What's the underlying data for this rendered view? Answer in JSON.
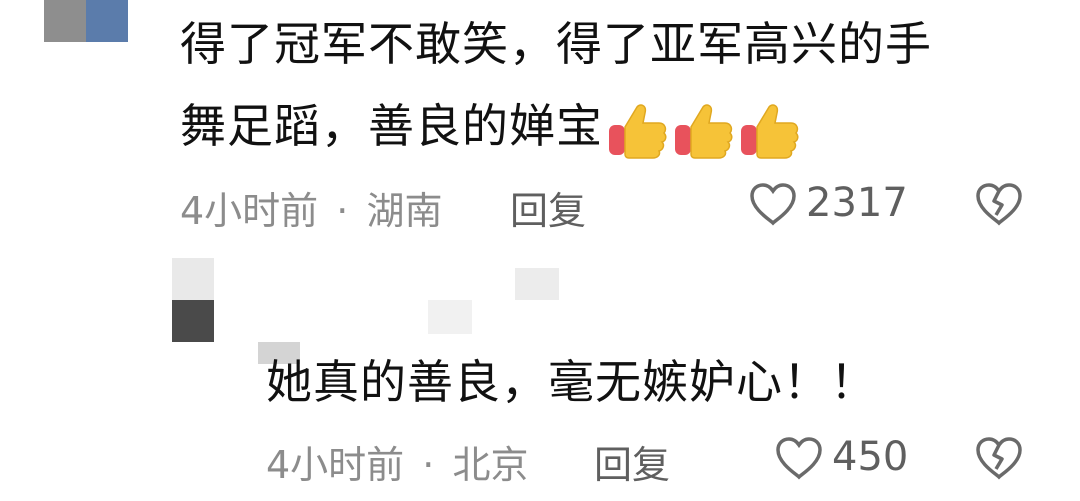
{
  "comments": [
    {
      "text_line1": "得了冠军不敢笑，得了亚军高兴的手",
      "text_line2": "舞足蹈，善良的婵宝",
      "emoji_count": 3,
      "emoji_icon": "thumbs-up-icon",
      "time": "4小时前",
      "separator": "·",
      "location": "湖南",
      "reply_label": "回复",
      "like_count": "2317"
    },
    {
      "text": "她真的善良，毫无嫉妒心！！",
      "time": "4小时前",
      "separator": "·",
      "location": "北京",
      "reply_label": "回复",
      "like_count": "450"
    }
  ],
  "colors": {
    "text": "#111111",
    "meta": "#8c8c8c",
    "thumb_yellow": "#f6c338",
    "thumb_red": "#e8525c"
  }
}
